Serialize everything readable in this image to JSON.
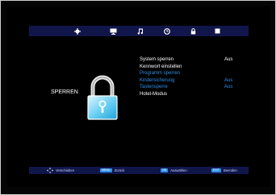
{
  "menu": {
    "title": "SPERREN",
    "tabs": [
      {
        "icon": "gear-icon"
      },
      {
        "icon": "monitor-icon"
      },
      {
        "icon": "music-note-icon"
      },
      {
        "icon": "clock-icon"
      },
      {
        "icon": "lock-icon",
        "active": true
      },
      {
        "icon": "square-icon"
      }
    ],
    "items": [
      {
        "label": "System sperren",
        "value": "Aus",
        "color": "#ffffff"
      },
      {
        "label": "Kennwort einstellen",
        "value": "",
        "color": "#ffffff"
      },
      {
        "label": "Programm sperren",
        "value": "",
        "color": "#2f8fe6"
      },
      {
        "label": "Kindersicherung",
        "value": "Aus",
        "color": "#2f8fe6"
      },
      {
        "label": "Tastensperre",
        "value": "Aus",
        "color": "#2f8fe6"
      },
      {
        "label": "Hotel-Modus",
        "value": "",
        "color": "#ffffff"
      }
    ]
  },
  "footer": {
    "hints": [
      {
        "key": "",
        "label": "Verschieben",
        "icon": "dpad-icon"
      },
      {
        "key": "MENU",
        "label": "Zurück"
      },
      {
        "key": "OK",
        "label": "Auswählen"
      },
      {
        "key": "EXIT",
        "label": "Beenden"
      }
    ]
  },
  "colors": {
    "bar": "#11164a",
    "highlight": "#2f8fe6",
    "background": "#000000"
  }
}
